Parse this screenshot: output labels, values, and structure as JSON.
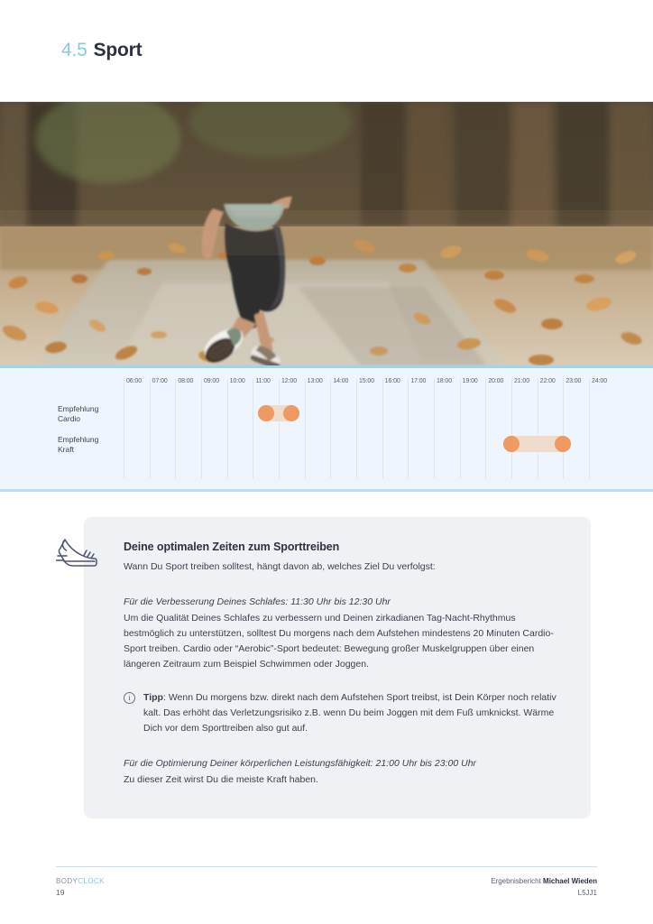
{
  "header": {
    "section_number": "4.5",
    "title": "Sport"
  },
  "hero": {
    "alt": "runner-photo",
    "description": "Person von hinten beim Joggen auf einem herbstlichen Laubweg"
  },
  "chart_data": {
    "type": "table",
    "title": "",
    "xlabel": "",
    "ylabel": "",
    "x_ticks": [
      "06:00",
      "07:00",
      "08:00",
      "09:00",
      "10:00",
      "11:00",
      "12:00",
      "13:00",
      "14:00",
      "15:00",
      "16:00",
      "17:00",
      "18:00",
      "19:00",
      "20:00",
      "21:00",
      "22:00",
      "23:00",
      "24:00"
    ],
    "xlim": [
      6,
      24
    ],
    "grid": true,
    "legend": "none",
    "categories": [
      "Empfehlung Cardio",
      "Empfehlung Kraft"
    ],
    "series": [
      {
        "name": "Empfehlung Cardio",
        "label_line1": "Empfehlung",
        "label_line2": "Cardio",
        "start": "11:30",
        "end": "12:30",
        "start_hour": 11.5,
        "end_hour": 12.5
      },
      {
        "name": "Empfehlung Kraft",
        "label_line1": "Empfehlung",
        "label_line2": "Kraft",
        "start": "21:00",
        "end": "23:00",
        "start_hour": 21.0,
        "end_hour": 23.0
      }
    ],
    "colors": {
      "bar_track": "#f0dccb",
      "bar_marker": "#ef9a63",
      "band_background": "#eef5fd",
      "gridline": "#dde5ee"
    }
  },
  "card": {
    "icon": "running-shoe-icon",
    "heading": "Deine optimalen Zeiten zum Sporttreiben",
    "lead": "Wann Du Sport treiben solltest, hängt davon ab, welches Ziel Du verfolgst:",
    "section1_heading": "Für die Verbesserung Deines Schlafes: 11:30 Uhr bis 12:30 Uhr",
    "section1_body": "Um die Qualität Deines Schlafes zu verbessern und Deinen zirkadianen Tag-Nacht-Rhythmus bestmöglich zu unterstützen, solltest Du morgens nach dem Aufstehen mindestens 20 Minuten Cardio-Sport treiben. Cardio oder “Aerobic”-Sport bedeutet: Bewegung großer Muskelgruppen über einen längeren Zeitraum zum Beispiel Schwimmen oder Joggen.",
    "tip_label": "Tipp",
    "tip_body": ": Wenn Du morgens bzw. direkt nach dem Aufstehen Sport treibst, ist Dein Körper noch relativ kalt. Das erhöht das Verletzungsrisiko z.B. wenn Du beim Joggen mit dem Fuß umknickst. Wärme Dich vor dem Sporttreiben also gut auf.",
    "section2_heading": "Für die Optimierung Deiner körperlichen Leistungsfähigkeit: 21:00 Uhr bis 23:00 Uhr",
    "section2_body": "Zu dieser Zeit wirst Du die meiste Kraft haben."
  },
  "footer": {
    "brand_first": "BODY",
    "brand_second": "CLOCK",
    "page_number": "19",
    "report_label": "Ergebnisbericht",
    "report_name": "Michael Wieden",
    "report_code": "L5JJ1"
  },
  "theme": {
    "accent_blue": "#87c8ec",
    "text_dark": "#2c3142",
    "card_bg": "#f0f1f5"
  }
}
